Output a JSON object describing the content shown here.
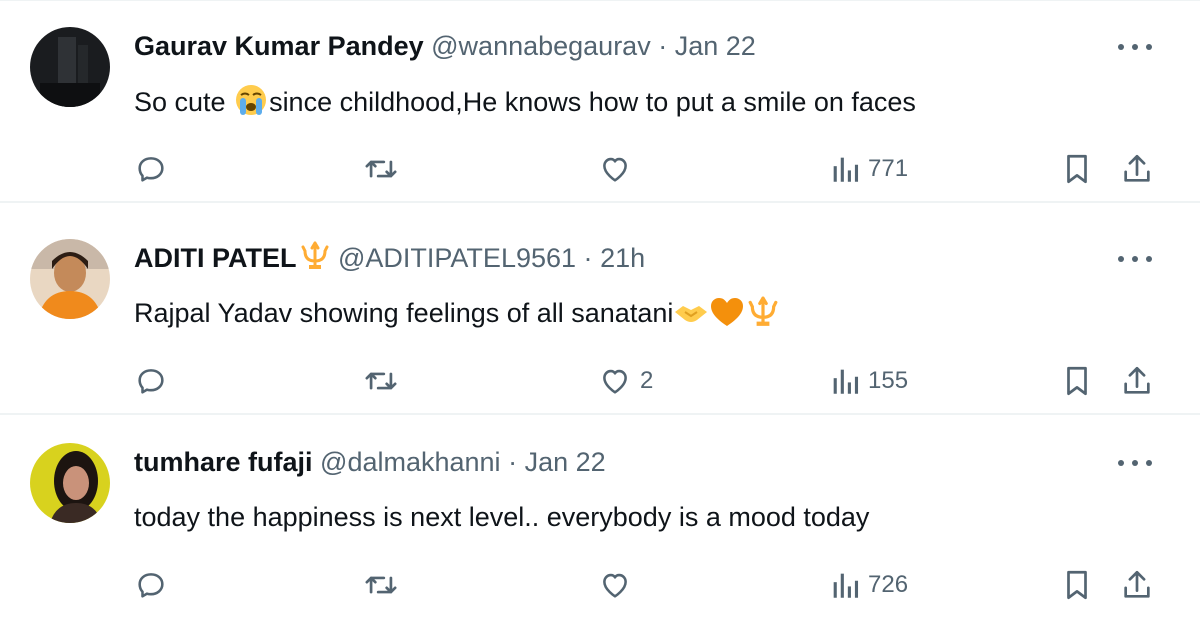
{
  "tweets": [
    {
      "name": "Gaurav Kumar Pandey",
      "handle": "@wannabegaurav",
      "separator": "·",
      "time": "Jan 22",
      "text_before": "So cute ",
      "text_after": "since childhood,He knows how to put a smile on faces",
      "likes": "",
      "views": "771",
      "emoji": "loudly-crying-face"
    },
    {
      "name": "ADITI PATEL",
      "handle": "@ADITIPATEL9561",
      "separator": "·",
      "time": "21h",
      "text_before": "Rajpal Yadav showing feelings of all sanatani",
      "likes": "2",
      "views": "155",
      "badge": "trident-icon"
    },
    {
      "name": "tumhare fufaji",
      "handle": "@dalmakhanni",
      "separator": "·",
      "time": "Jan 22",
      "text_before": "today the happiness is next level.. everybody is a mood today",
      "likes": "",
      "views": "726"
    }
  ],
  "colors": {
    "text": "#0f1419",
    "secondary": "#536471",
    "divider": "#eff3f4",
    "orange_heart": "#f4900c",
    "saffron": "#ffac33"
  }
}
